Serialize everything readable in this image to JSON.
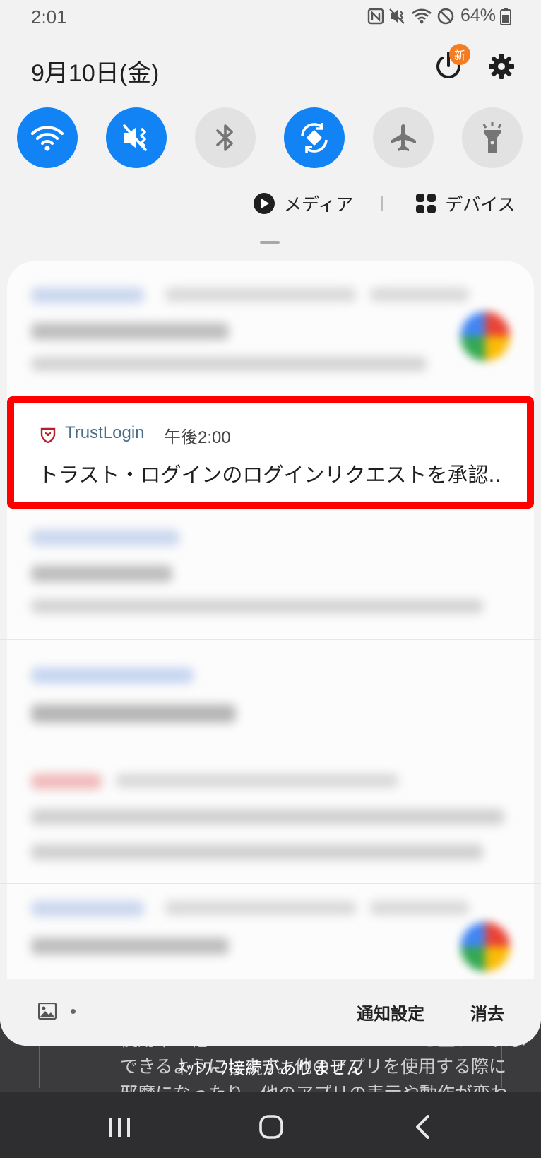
{
  "status_bar": {
    "time": "2:01",
    "battery": "64%",
    "icons": [
      "nfc-icon",
      "vibrate-mute-icon",
      "wifi-icon",
      "do-not-disturb-icon",
      "battery-icon"
    ]
  },
  "header": {
    "date": "9月10日(金)",
    "new_badge": "新",
    "icons": [
      "power-icon",
      "gear-icon"
    ]
  },
  "quick_toggles": [
    {
      "name": "wifi",
      "icon": "wifi-icon",
      "state": "on"
    },
    {
      "name": "sound-mute",
      "icon": "mute-vibrate-icon",
      "state": "on"
    },
    {
      "name": "bluetooth",
      "icon": "bluetooth-icon",
      "state": "off"
    },
    {
      "name": "auto-rotate",
      "icon": "rotate-icon",
      "state": "on"
    },
    {
      "name": "airplane-mode",
      "icon": "airplane-icon",
      "state": "off"
    },
    {
      "name": "flashlight",
      "icon": "flashlight-icon",
      "state": "off"
    }
  ],
  "media_row": {
    "media_label": "メディア",
    "devices_label": "デバイス"
  },
  "highlighted_notification": {
    "app_name": "TrustLogin",
    "time": "午後2:00",
    "message": "トラスト・ログインのログインリクエストを承認.."
  },
  "footer": {
    "notification_settings": "通知設定",
    "clear": "消去"
  },
  "background": {
    "line1": "使用中の他のアプリの上にこのアプリを重ねて表示",
    "line2": "できるようにします。他のアプリを使用する際に",
    "line3": "邪魔になったり、他のアプリの表示や動作が変わ"
  },
  "toast": "ﾈｯﾄﾜｰｸ接続がありません",
  "colors": {
    "accent": "#1183f4",
    "highlight_border": "#ff0000",
    "badge": "#f57c20"
  }
}
